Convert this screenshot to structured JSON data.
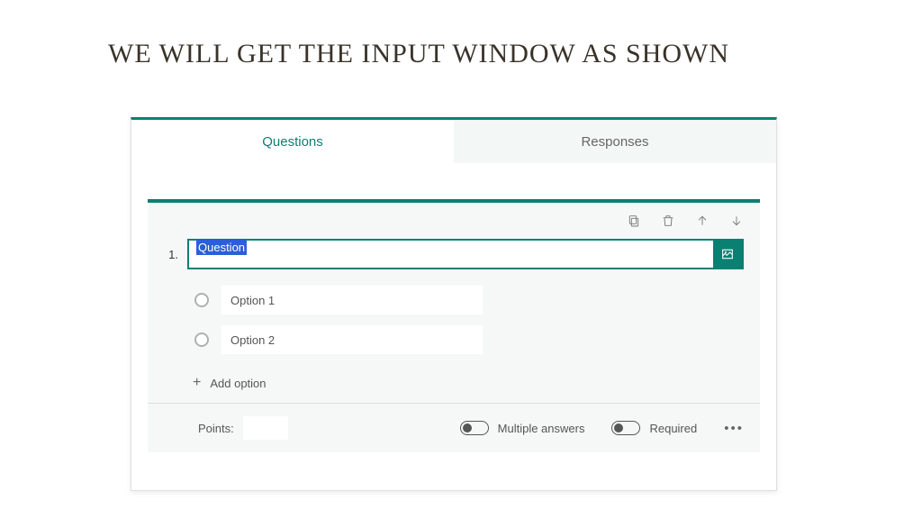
{
  "slide": {
    "title": "WE WILL GET THE INPUT WINDOW AS SHOWN"
  },
  "tabs": {
    "questions": "Questions",
    "responses": "Responses"
  },
  "question": {
    "number": "1.",
    "text": "Question",
    "options": [
      "Option 1",
      "Option 2"
    ],
    "addOption": "Add option"
  },
  "footer": {
    "pointsLabel": "Points:",
    "pointsValue": "",
    "multiLabel": "Multiple answers",
    "requiredLabel": "Required"
  }
}
